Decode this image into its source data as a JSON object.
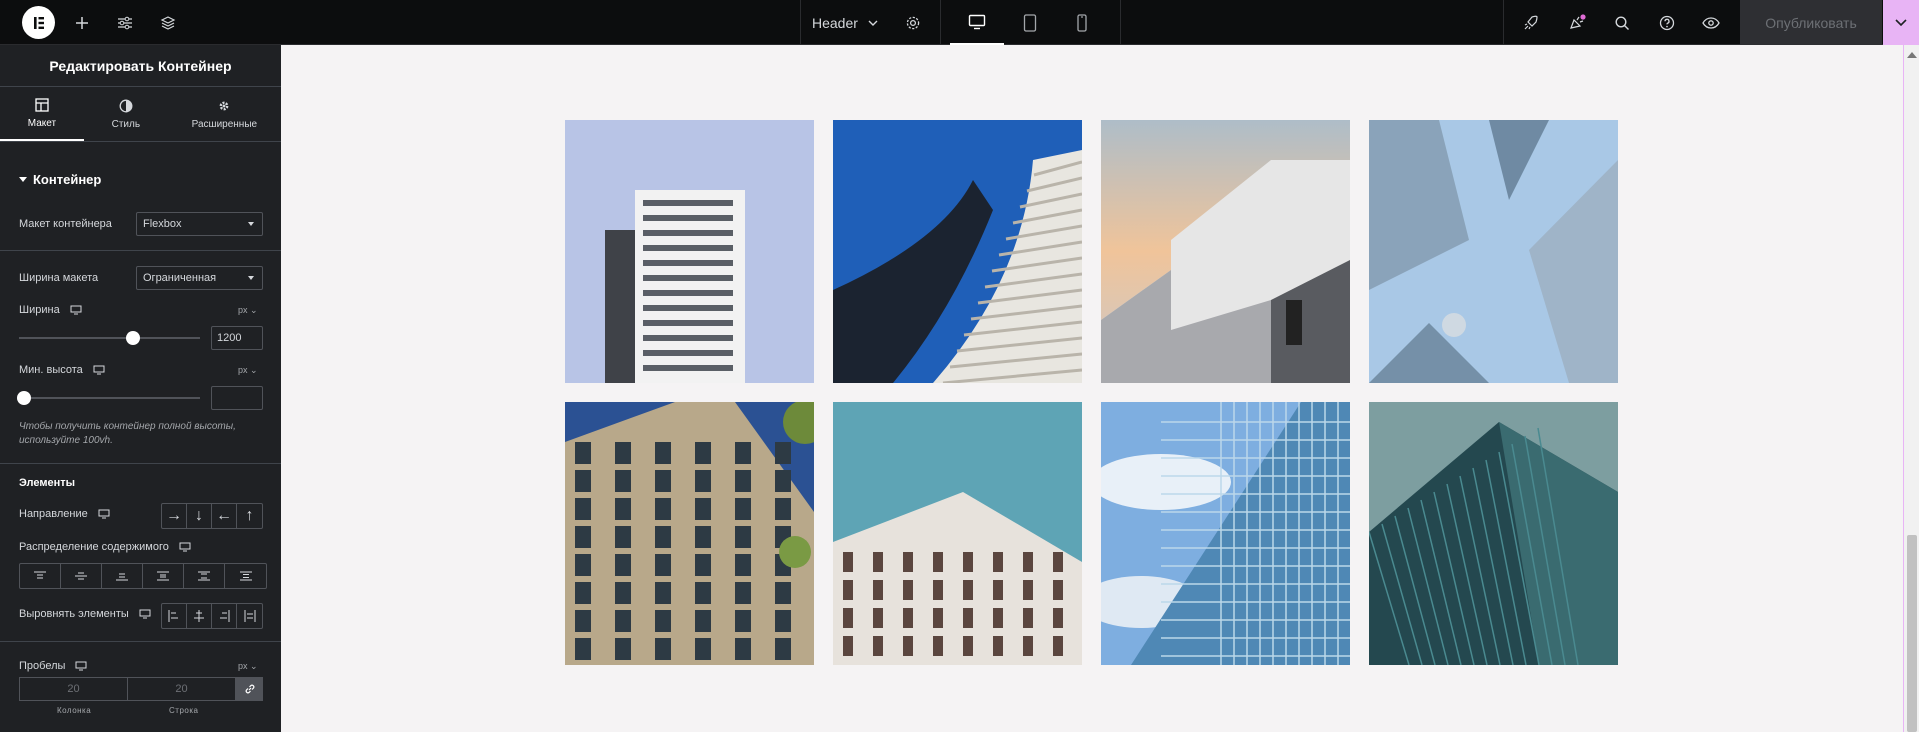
{
  "topbar": {
    "header_dropdown": "Header",
    "publish_label": "Опубликовать"
  },
  "panel": {
    "title": "Редактировать Контейнер",
    "tabs": [
      {
        "label": "Макет",
        "icon": "layout-icon"
      },
      {
        "label": "Стиль",
        "icon": "contrast-icon"
      },
      {
        "label": "Расширенные",
        "icon": "gear-icon"
      }
    ],
    "section_title": "Контейнер",
    "container_layout_label": "Макет контейнера",
    "container_layout_value": "Flexbox",
    "content_width_label": "Ширина макета",
    "content_width_value": "Ограниченная",
    "width_label": "Ширина",
    "width_unit": "px",
    "width_value": "1200",
    "width_slider_fraction": 0.63,
    "min_height_label": "Мин. высота",
    "min_height_unit": "px",
    "min_height_value": "",
    "min_height_slider_fraction": 0,
    "hint": "Чтобы получить контейнер полной высоты, используйте 100vh.",
    "elements_title": "Элементы",
    "direction_label": "Направление",
    "justify_label": "Распределение содержимого",
    "align_label": "Выровнять элементы",
    "gaps_label": "Пробелы",
    "gaps_unit": "px",
    "gap_column_value": "20",
    "gap_row_value": "20",
    "gap_column_label": "Колонка",
    "gap_row_label": "Строка"
  },
  "colors": {
    "topbar_bg": "#0c0d0e",
    "panel_bg": "#1f2124",
    "canvas_bg": "#f5f3f4",
    "accent": "#e8b4f5"
  },
  "gallery": {
    "images": [
      {
        "name": "white-apartment-tower",
        "sky": "#b8c4e6",
        "building": "#f2f2f2"
      },
      {
        "name": "curved-blue-tower",
        "sky": "#1f5fb8",
        "building": "#e8e6e0"
      },
      {
        "name": "white-geometric-building",
        "sky": "#c9cfd5",
        "building": "#e6e6e6"
      },
      {
        "name": "skyscrapers-from-below",
        "sky": "#a9c8e6",
        "building": "#7d96ad"
      },
      {
        "name": "facade-with-tree",
        "sky": "#2b5193",
        "building": "#b8a88a"
      },
      {
        "name": "brick-office-block",
        "sky": "#5ea4b5",
        "building": "#e7e2dc"
      },
      {
        "name": "glass-tower-clouds",
        "sky": "#7eaee0",
        "building": "#4f88b5"
      },
      {
        "name": "teal-glass-tower",
        "sky": "#7d9ea0",
        "building": "#24484f"
      }
    ]
  }
}
